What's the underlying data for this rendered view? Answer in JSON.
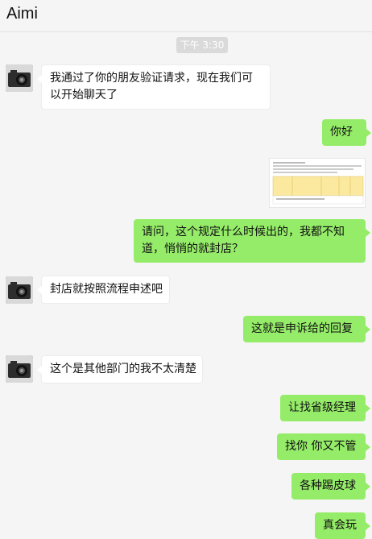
{
  "header": {
    "title": "Aimi"
  },
  "timestamp": "下午 3:30",
  "messages": [
    {
      "text": "我通过了你的朋友验证请求，现在我们可以开始聊天了"
    },
    {
      "text": "你好"
    },
    {
      "text": "请问，这个规定什么时候出的，我都不知道，悄悄的就封店？"
    },
    {
      "text": "封店就按照流程申述吧"
    },
    {
      "text": "这就是申诉给的回复"
    },
    {
      "text": "这个是其他部门的我不太清楚"
    },
    {
      "text": "让找省级经理"
    },
    {
      "text": "找你 你又不管"
    },
    {
      "text": "各种踢皮球"
    },
    {
      "text": "真会玩"
    }
  ],
  "colors": {
    "sent_bubble": "#95ec69",
    "received_bubble": "#ffffff",
    "background": "#f5f5f5"
  }
}
